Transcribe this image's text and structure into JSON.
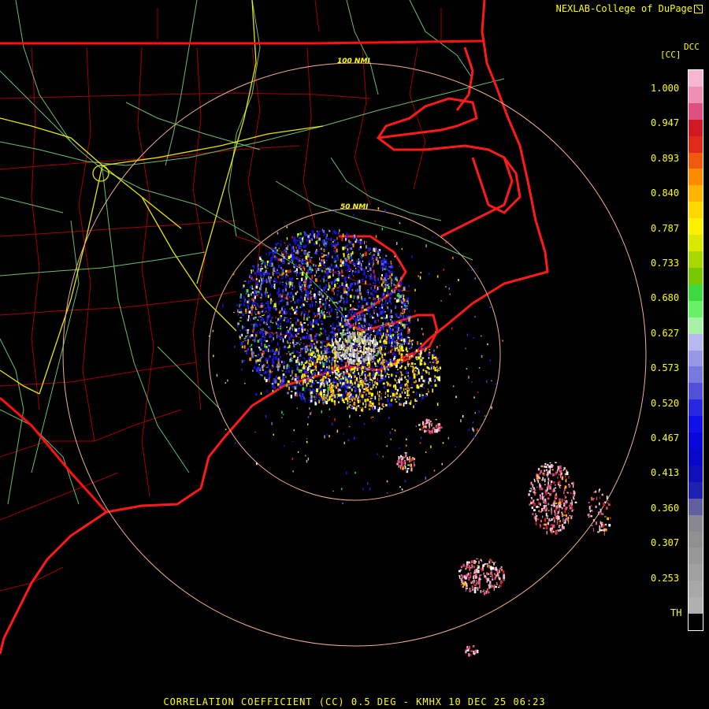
{
  "credit": "NEXLAB-College of DuPage",
  "legend": {
    "title_top": "DCC",
    "title_unit": "[CC]",
    "ticks": [
      "1.000",
      "0.947",
      "0.893",
      "0.840",
      "0.787",
      "0.733",
      "0.680",
      "0.627",
      "0.573",
      "0.520",
      "0.467",
      "0.413",
      "0.360",
      "0.307",
      "0.253",
      "TH"
    ],
    "colors": [
      "#f5b7cf",
      "#ef8fb5",
      "#e0507f",
      "#d11826",
      "#e02b1a",
      "#f05a10",
      "#ff8c00",
      "#ffb400",
      "#ffd800",
      "#fff000",
      "#d8e800",
      "#a8d800",
      "#78c800",
      "#40d840",
      "#68f068",
      "#a8f0a8",
      "#b8b8f0",
      "#9898e8",
      "#7878e0",
      "#5050d8",
      "#2828e0",
      "#1010e8",
      "#0808d8",
      "#0808c8",
      "#1010b8",
      "#2020b0",
      "#6060a0",
      "#888890",
      "#909090",
      "#989898",
      "#a0a0a0",
      "#a8a8a8",
      "#b0b0b0",
      "#000000"
    ]
  },
  "range_rings": {
    "inner_label": "50 NMI",
    "outer_label": "100 NMI"
  },
  "footer": "CORRELATION COEFFICIENT (CC) 0.5 DEG - KMHX 10 DEC 25 06:23",
  "colors": {
    "state_border": "#ff0000",
    "county_border": "#c80000",
    "highway": "#7ee07e",
    "interstate": "#ffff00",
    "range_ring": "#f0b090",
    "text": "#ffff00"
  }
}
